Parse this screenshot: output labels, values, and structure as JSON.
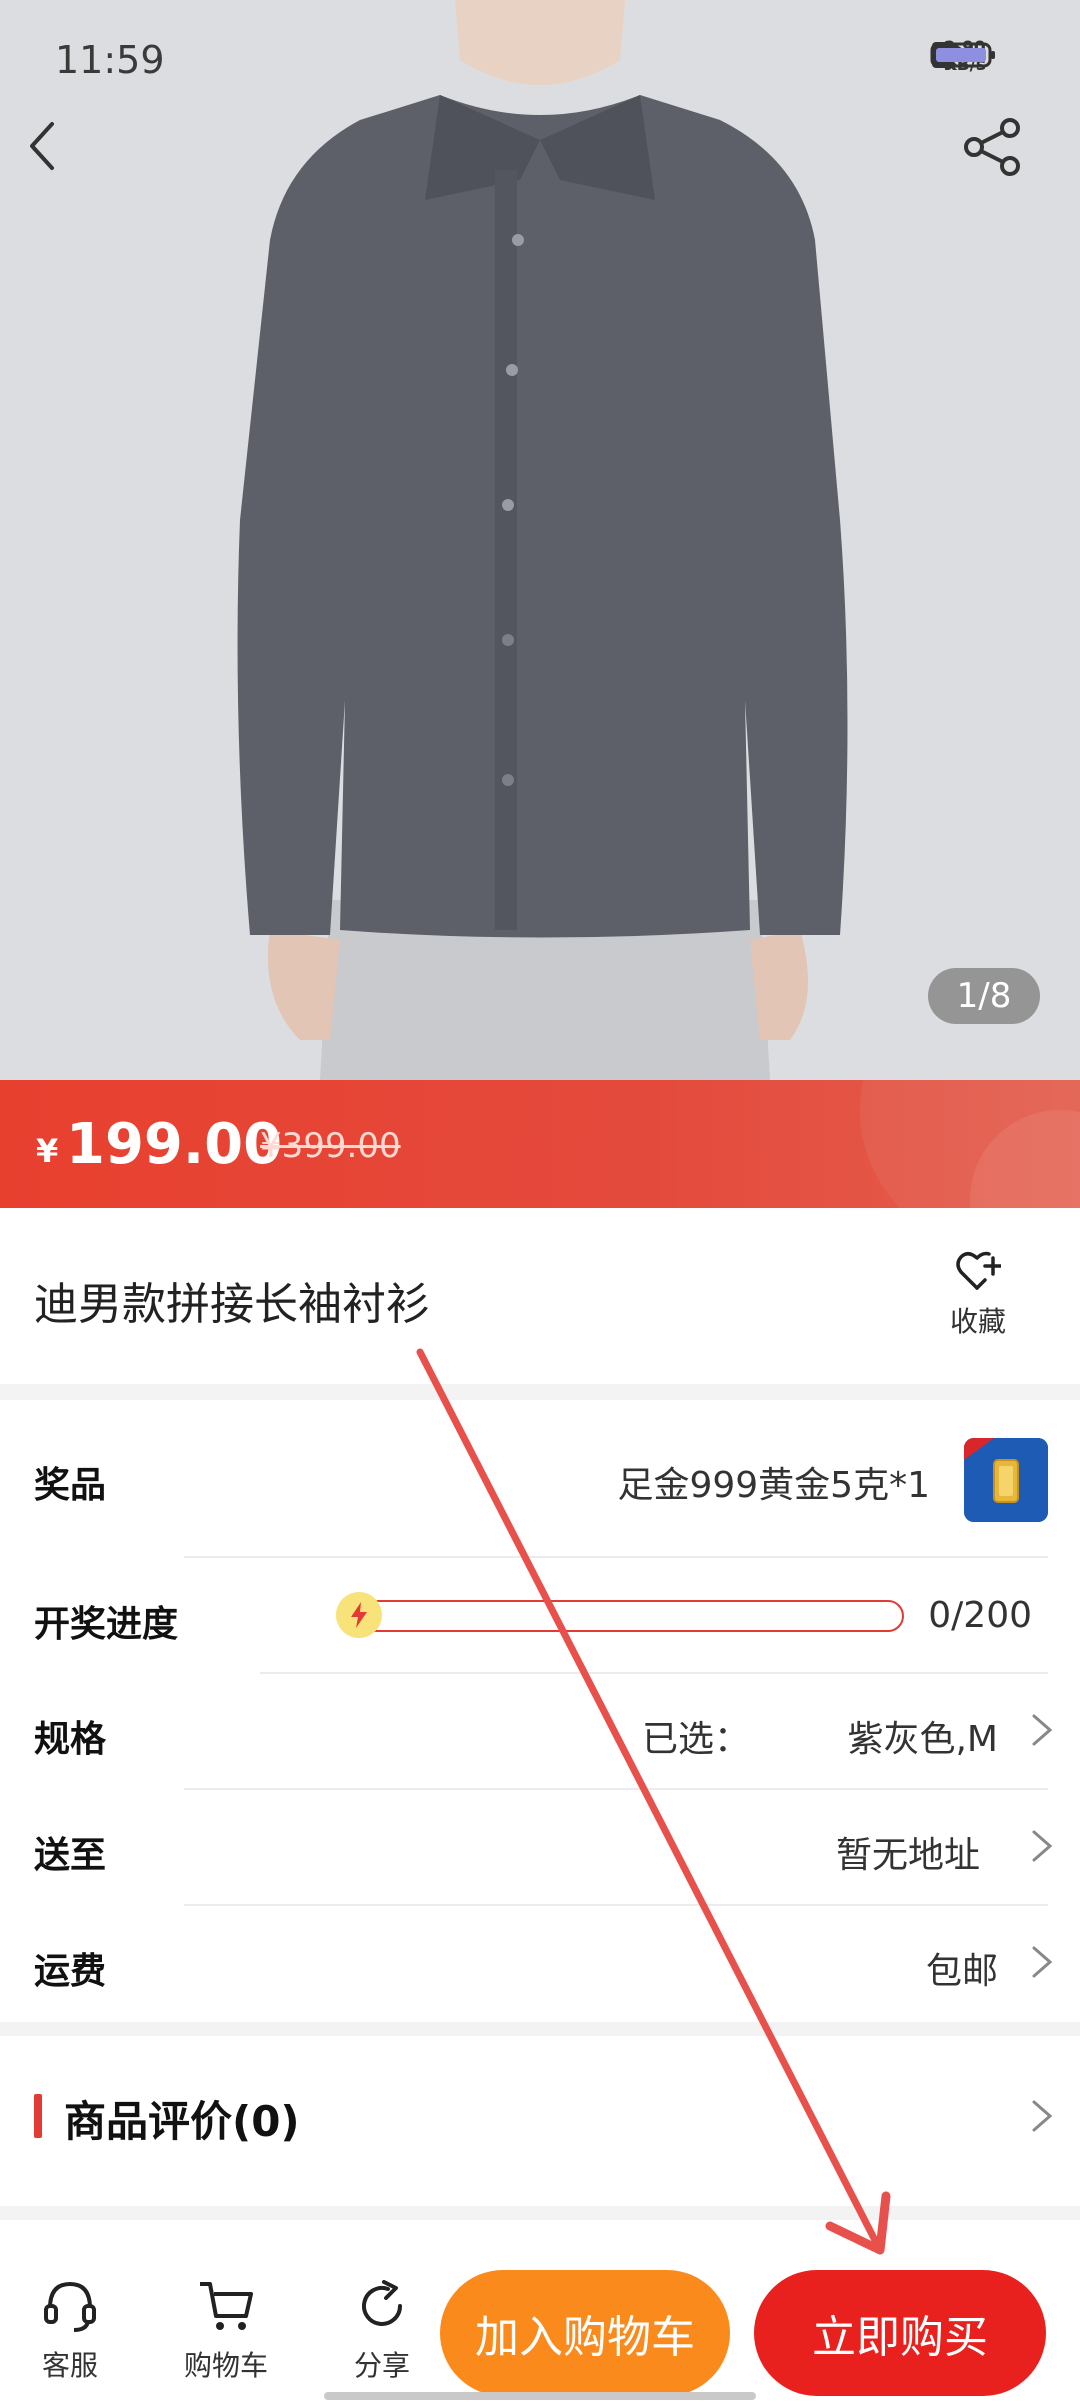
{
  "status_bar": {
    "time": "11:59",
    "speed_value": "2.90",
    "speed_unit": "KB/s"
  },
  "gallery": {
    "page_indicator": "1/8"
  },
  "price": {
    "currency": "¥",
    "current": "199.00",
    "original": "¥399.00"
  },
  "product": {
    "title": "迪男款拼接长袖衬衫",
    "favorite_label": "收藏"
  },
  "info": {
    "prize_label": "奖品",
    "prize_value": "足金999黄金5克*1",
    "progress_label": "开奖进度",
    "progress_value": "0/200",
    "progress_fraction": 0,
    "spec_label": "规格",
    "spec_prefix": "已选：",
    "spec_value": "紫灰色,M",
    "ship_label": "送至",
    "ship_value": "暂无地址",
    "fee_label": "运费",
    "fee_value": "包邮"
  },
  "reviews": {
    "title": "商品评价(0)"
  },
  "bottom_bar": {
    "service_label": "客服",
    "cart_label": "购物车",
    "share_label": "分享",
    "add_to_cart": "加入购物车",
    "buy_now": "立即购买"
  },
  "colors": {
    "accent_red": "#e8211f",
    "banner_red": "#e8402f",
    "orange": "#fb8a1c"
  }
}
